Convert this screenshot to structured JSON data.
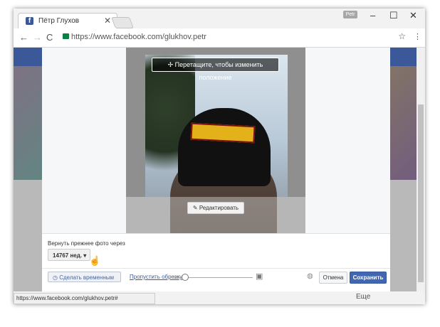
{
  "browser": {
    "tab_title": "Пётр Глухов",
    "tab_close": "✕",
    "profile_name": "Petr",
    "url": "https://www.facebook.com/glukhov.petr",
    "status_url": "https://www.facebook.com/glukhov.petr#"
  },
  "window_controls": {
    "minimize": "–",
    "maximize": "☐",
    "close": "✕"
  },
  "toolbar": {
    "back": "←",
    "forward": "→",
    "reload": "C",
    "bookmark": "☆",
    "menu": "⋮"
  },
  "dialog": {
    "drag_hint": "✢ Перетащите, чтобы изменить положение",
    "edit_button": "✎ Редактировать",
    "revert_label": "Вернуть прежнее фото через",
    "revert_value": "14767 нед. ▾",
    "make_temporary": "◷ Сделать временным",
    "skip_crop": "Пропустить обрезку",
    "cancel": "Отмена",
    "save": "Сохранить"
  },
  "page": {
    "more_label": "Еще"
  },
  "colors": {
    "facebook_blue": "#3b5998",
    "save_blue": "#4267b2"
  }
}
